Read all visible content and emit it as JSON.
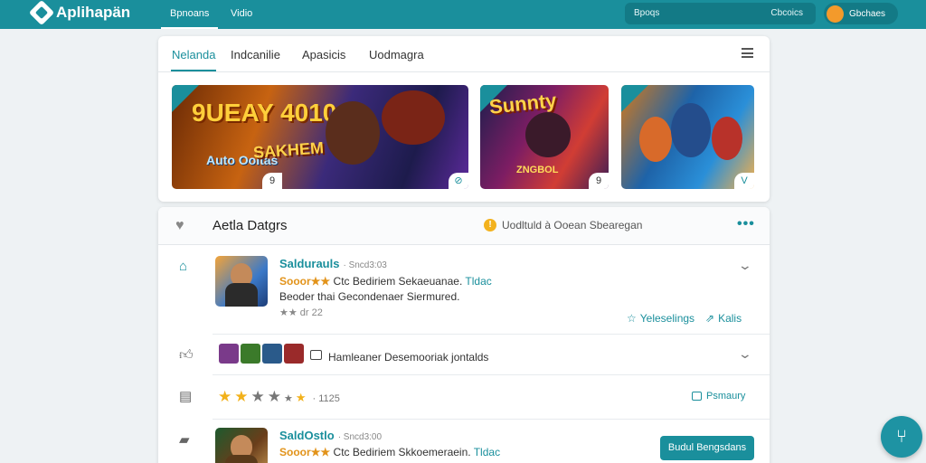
{
  "app": {
    "name": "Aplihapän"
  },
  "nav": {
    "items": [
      "Bpnoans",
      "Vidio"
    ]
  },
  "search": {
    "placeholder": "Bpoqs",
    "button": "Cbcoics"
  },
  "user": {
    "label": "Gbchaes"
  },
  "games": {
    "tabs": [
      "Nelanda",
      "Indcanilie",
      "Apasicis",
      "Uodmagra"
    ],
    "banners": [
      {
        "title": "9UEAY 4010",
        "subtitle": "Auto Ooitas",
        "title2": "SAKHEM",
        "badge": "9"
      },
      {
        "title": "Sunnty",
        "subtitle": "ZNGBOL",
        "badge": "9"
      },
      {
        "badge": "V"
      }
    ]
  },
  "recent": {
    "title": "Aetla Datgrs",
    "note": "Uodltuld à Ooean Sbearegan",
    "items": [
      {
        "title": "Saldurauls",
        "time": "· Sncd3:03",
        "rating_label": "Sooor★★",
        "line1": "Ctc Bediriem Sekaeuanae.",
        "line1_tail": "Tldac",
        "line2": "Beoder thai Gecondenaer Siermured.",
        "stars": "★★ dr 22",
        "action1": "Yeleselings",
        "action2": "Kalis"
      },
      {
        "line": "Hamleaner Desemooriak jontalds"
      },
      {
        "stars_meta": "· 1125",
        "summary": "Psmaury"
      },
      {
        "title": "SaldOstlo",
        "time": "· Sncd3:00",
        "rating_label": "Sooor★★",
        "line1": "Ctc Bediriem Skkoemeraein.",
        "line1_tail": "Tldac",
        "cta": "Budul Bengsdans"
      }
    ]
  },
  "colors": {
    "accent": "#1a8f9c",
    "star": "#f2b11a",
    "warning": "#f3b21e"
  }
}
